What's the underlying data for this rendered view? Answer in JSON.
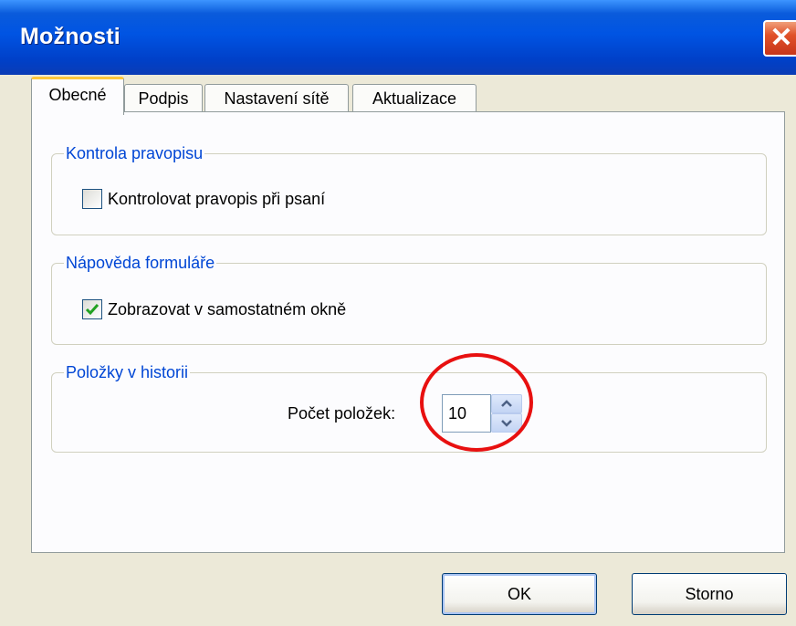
{
  "window": {
    "title": "Možnosti"
  },
  "tabs": [
    {
      "label": "Obecné",
      "active": true
    },
    {
      "label": "Podpis",
      "active": false
    },
    {
      "label": "Nastavení sítě",
      "active": false
    },
    {
      "label": "Aktualizace",
      "active": false
    }
  ],
  "spellcheck": {
    "legend": "Kontrola pravopisu",
    "checkbox_label": "Kontrolovat pravopis při psaní",
    "checked": false
  },
  "form_help": {
    "legend": "Nápověda formuláře",
    "checkbox_label": "Zobrazovat v samostatném okně",
    "checked": true
  },
  "history": {
    "legend": "Položky v historii",
    "count_label": "Počet položek:",
    "count_value": "10"
  },
  "buttons": {
    "ok": "OK",
    "cancel": "Storno"
  },
  "colors": {
    "title_bar": "#0054e3",
    "legend_text": "#0046d5",
    "annotation_circle": "#e81010",
    "check_mark": "#21a121"
  }
}
